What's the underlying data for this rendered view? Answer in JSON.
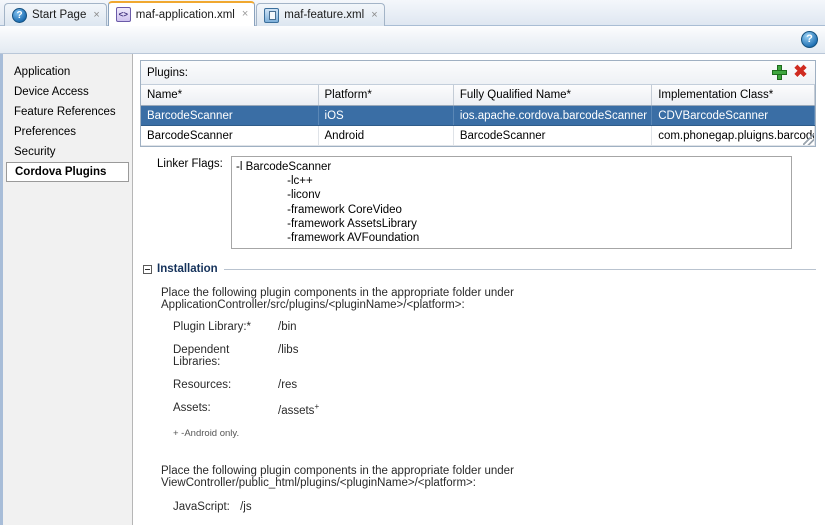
{
  "tabs": [
    {
      "label": "Start Page",
      "icon": "help-circle-icon",
      "glyph": "?",
      "active": false,
      "close": "×"
    },
    {
      "label": "maf-application.xml",
      "icon": "xml-file-icon",
      "glyph": "<>",
      "active": true,
      "close": "×"
    },
    {
      "label": "maf-feature.xml",
      "icon": "device-feature-icon",
      "glyph": "",
      "active": false,
      "close": "×"
    }
  ],
  "toolbar": {
    "help_icon": "help-circle-icon",
    "help_glyph": "?"
  },
  "sidebar": {
    "items": [
      {
        "label": "Application",
        "selected": false
      },
      {
        "label": "Device Access",
        "selected": false
      },
      {
        "label": "Feature References",
        "selected": false
      },
      {
        "label": "Preferences",
        "selected": false
      },
      {
        "label": "Security",
        "selected": false
      },
      {
        "label": "Cordova Plugins",
        "selected": true
      }
    ]
  },
  "plugins": {
    "title": "Plugins:",
    "add_icon": "add-plus-icon",
    "delete_icon": "delete-cross-icon",
    "delete_glyph": "✖",
    "columns": [
      "Name*",
      "Platform*",
      "Fully Qualified Name*",
      "Implementation Class*"
    ],
    "rows": [
      {
        "selected": true,
        "cells": [
          "BarcodeScanner",
          "iOS",
          "ios.apache.cordova.barcodeScanner",
          "CDVBarcodeScanner"
        ]
      },
      {
        "selected": false,
        "cells": [
          "BarcodeScanner",
          "Android",
          "BarcodeScanner",
          "com.phonegap.pluigns.barcode…"
        ]
      }
    ]
  },
  "linker": {
    "label": "Linker Flags:",
    "value": "-l BarcodeScanner\n                -lc++\n                -liconv\n                -framework CoreVideo\n                -framework AssetsLibrary\n                -framework AVFoundation"
  },
  "installation": {
    "title": "Installation",
    "collapse_icon": "collapse-minus-icon",
    "paragraph1": "Place the following plugin components in the appropriate folder under ApplicationController/src/plugins/<pluginName>/<platform>:",
    "items": [
      {
        "key": "Plugin Library:*",
        "value": "/bin",
        "sup": ""
      },
      {
        "key": "Dependent Libraries:",
        "value": "/libs",
        "sup": ""
      },
      {
        "key": "Resources:",
        "value": "/res",
        "sup": ""
      },
      {
        "key": "Assets:",
        "value": "/assets",
        "sup": "+"
      }
    ],
    "footnote": "+ -Android only.",
    "paragraph2": "Place the following plugin components in the appropriate folder under ViewController/public_html/plugins/<pluginName>/<platform>:",
    "javascript_key": "JavaScript:",
    "javascript_value": "/js"
  },
  "colors": {
    "selection_blue": "#3a6ea5",
    "accent_orange": "#f0a830",
    "section_title": "#15325b",
    "add_green": "#3fa63f",
    "delete_red": "#cf2b20"
  }
}
